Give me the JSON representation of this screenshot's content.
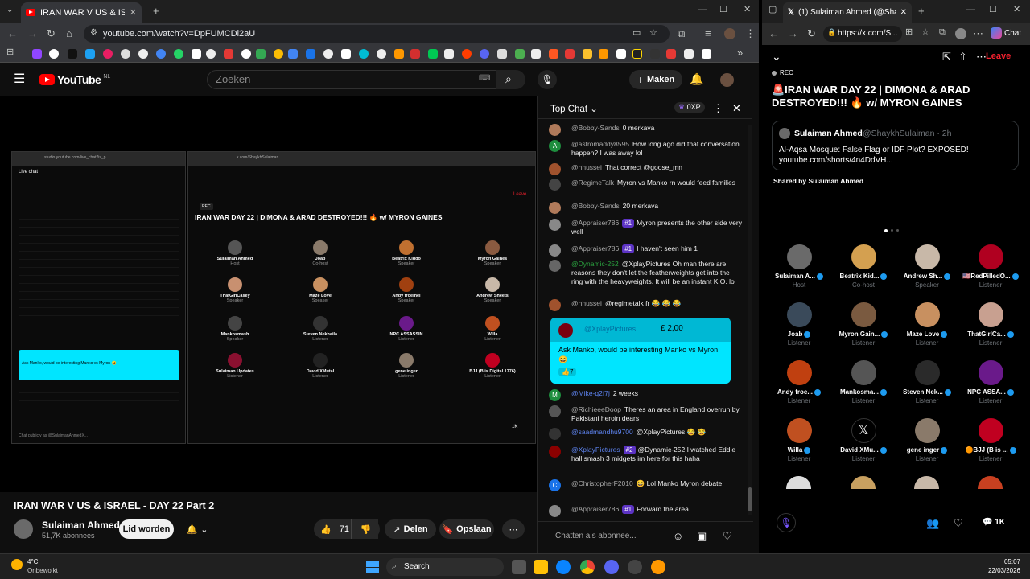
{
  "left_browser": {
    "tab_title": "IRAN WAR V US & ISRAEL - ",
    "url": "youtube.com/watch?v=DpFUMCDl2aU"
  },
  "youtube": {
    "logo": "YouTube",
    "region": "NL",
    "search_placeholder": "Zoeken",
    "create_label": "Maken",
    "video_title": "IRAN WAR V US & ISRAEL - DAY 22 Part 2",
    "channel_name": "Sulaiman Ahmed",
    "subscribers": "51,7K abonnees",
    "join_label": "Lid worden",
    "likes": "71",
    "share_label": "Delen",
    "save_label": "Opslaan",
    "player_mirror": {
      "left_url": "studio.youtube.com/live_chat?is_p...",
      "right_url": "x.com/ShaykhSulaiman",
      "livechat_label": "Live chat",
      "title": "IRAN WAR DAY 22 | DIMONA & ARAD DESTROYED!!! 🔥 w/ MYRON GAINES",
      "rec": "REC",
      "leave": "Leave",
      "chat_input": "Chat publicly as @SulaimanAhmedX...",
      "sc_text": "Ask Manko, would be interesting Manko vs Myron 😆",
      "sc_amount": "£ 2,00",
      "count": "1K",
      "tiles": [
        {
          "name": "Sulaiman Ahmed",
          "role": "Host"
        },
        {
          "name": "Joab",
          "role": "Co-host"
        },
        {
          "name": "Beatrix Kiddo",
          "role": "Speaker"
        },
        {
          "name": "Myron Gaines",
          "role": "Speaker"
        },
        {
          "name": "ThatGirlCasey",
          "role": "Speaker"
        },
        {
          "name": "Maze Love",
          "role": "Speaker"
        },
        {
          "name": "Andy froemel",
          "role": "Speaker"
        },
        {
          "name": "Andrew Sheets",
          "role": "Speaker"
        },
        {
          "name": "Mankosmash",
          "role": "Speaker"
        },
        {
          "name": "Steven Nekhaila",
          "role": "Listener"
        },
        {
          "name": "NPC ASSASSIN",
          "role": "Listener"
        },
        {
          "name": "Willa",
          "role": "Listener"
        },
        {
          "name": "Sulaiman Updates",
          "role": "Listener"
        },
        {
          "name": "David XMutal",
          "role": "Listener"
        },
        {
          "name": "gene inger",
          "role": "Listener"
        },
        {
          "name": "BJJ (B is Digital 1776)",
          "role": "Listener"
        }
      ]
    }
  },
  "chat": {
    "header": "Top Chat",
    "xp": "0XP",
    "messages": [
      {
        "author": "@Bobby-Sands",
        "text": "0 merkava",
        "badge": "",
        "color": "#b07a5a"
      },
      {
        "author": "@astromaddy8595",
        "text": "How long ago did that conversation happen? I was away lol",
        "badge": "",
        "color": "#1e8e3e",
        "initial": "A"
      },
      {
        "author": "@hhussei",
        "text": "That correct @goose_mn",
        "badge": "",
        "color": "#a0522d"
      },
      {
        "author": "@RegimeTalk",
        "text": "Myron vs Manko rn would feed families",
        "badge": "",
        "color": "#444"
      },
      {
        "author": "@Bobby-Sands",
        "text": "20 merkava",
        "badge": "",
        "color": "#b07a5a"
      },
      {
        "author": "@Appraiser786",
        "text": "Myron presents the other side very well",
        "badge": "#1",
        "color": "#888"
      },
      {
        "author": "@Appraiser786",
        "text": "I haven't seen him 1",
        "badge": "#1",
        "color": "#888"
      },
      {
        "author": "@Dynamic-252",
        "text": "@XplayPictures Oh man there are reasons they don't let the featherweights get into the ring with the heavyweights. It will be an instant K.O. lol",
        "badge": "",
        "color": "#666"
      },
      {
        "author": "@hhussei",
        "text": "@regimetalk fr 😂 😂 😂",
        "badge": "",
        "color": "#a0522d"
      },
      {
        "author": "@Mike-q2f7j",
        "text": "2 weeks",
        "badge": "",
        "color": "#1e8e3e",
        "initial": "M"
      },
      {
        "author": "@RichieeeDoop",
        "text": "Theres an area in England overrun by Pakistani heroin dears",
        "badge": "",
        "color": "#555"
      },
      {
        "author": "@saadmandhu9700",
        "text": "@XplayPictures 😂 😂",
        "badge": "",
        "color": "#333"
      },
      {
        "author": "@XplayPictures",
        "text": "@Dynamic-252 I watched Eddie hall smash 3 midgets im here for this haha",
        "badge": "#2",
        "color": "#8b0000"
      },
      {
        "author": "@ChristopherF2010",
        "text": "😆 Lol Manko Myron debate",
        "badge": "",
        "color": "#1a73e8",
        "initial": "C"
      },
      {
        "author": "@Appraiser786",
        "text": "Forward the area",
        "badge": "#1",
        "color": "#888"
      }
    ],
    "superchat": {
      "author": "@XplayPictures",
      "amount": "£ 2,00",
      "text": "Ask Manko, would be interesting Manko vs Myron 😆",
      "reactions": "7"
    },
    "input_placeholder": "Chatten als abonnee..."
  },
  "right_browser": {
    "tab_title": "(1) Sulaiman Ahmed (@ShaykhSul",
    "url": "https://x.com/S...",
    "chat_label": "Chat",
    "leave": "Leave",
    "rec": "REC",
    "space_title": "🚨IRAN WAR DAY 22 | DIMONA & ARAD DESTROYED!!! 🔥 w/ MYRON GAINES",
    "pinned": {
      "name": "Sulaiman Ahmed",
      "handle": "@ShaykhSulaiman · 2h",
      "text": "Al-Aqsa Mosque: False Flag or IDF Plot? EXPOSED! youtube.com/shorts/4n4DdVH...",
      "shared": "Shared by Sulaiman Ahmed"
    },
    "count": "1K",
    "tiles": [
      {
        "name": "Sulaiman A...",
        "role": "Host",
        "color": "#6a6a6a"
      },
      {
        "name": "Beatrix Kid...",
        "role": "Co-host",
        "color": "#d4a050"
      },
      {
        "name": "Andrew Sh...",
        "role": "Speaker",
        "color": "#c8b8a8"
      },
      {
        "name": "🇺🇸RedPilledO...",
        "role": "Listener",
        "color": "#b00020"
      },
      {
        "name": "Joab",
        "role": "Listener",
        "color": "#3a4a5a"
      },
      {
        "name": "Myron Gain...",
        "role": "Listener",
        "color": "#7a5a40"
      },
      {
        "name": "Maze Love",
        "role": "Listener",
        "color": "#c89060"
      },
      {
        "name": "ThatGirlCa...",
        "role": "Listener",
        "color": "#c8a090"
      },
      {
        "name": "Andy froe...",
        "role": "Listener",
        "color": "#c04010"
      },
      {
        "name": "Mankosma...",
        "role": "Listener",
        "color": "#555"
      },
      {
        "name": "Steven Nek...",
        "role": "Listener",
        "color": "#2a2a2a"
      },
      {
        "name": "NPC ASSA...",
        "role": "Listener",
        "color": "#6a1a8a"
      },
      {
        "name": "Willa",
        "role": "Listener",
        "color": "#c05020"
      },
      {
        "name": "David XMu...",
        "role": "Listener",
        "color": "#000"
      },
      {
        "name": "gene inger",
        "role": "Listener",
        "color": "#8a7a6a"
      },
      {
        "name": "🟠BJJ (B is ...",
        "role": "Listener",
        "color": "#c00020"
      }
    ]
  },
  "taskbar": {
    "temp": "4°C",
    "weather": "Onbewolkt",
    "search": "Search",
    "time": "05:07",
    "date": "22/03/2026"
  }
}
